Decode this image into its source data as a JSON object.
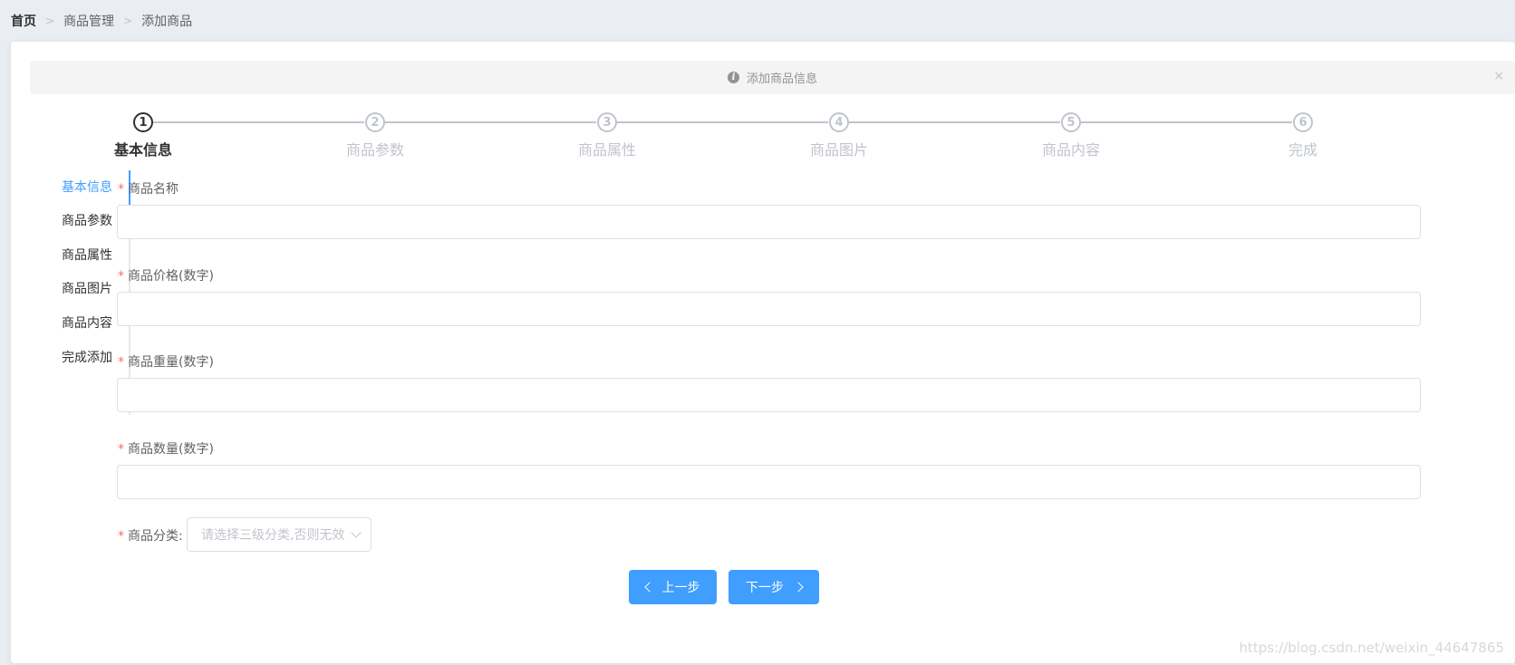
{
  "breadcrumb": [
    "首页",
    "商品管理",
    "添加商品"
  ],
  "alert": {
    "text": "添加商品信息",
    "close": "×"
  },
  "steps": [
    {
      "number": "1",
      "title": "基本信息"
    },
    {
      "number": "2",
      "title": "商品参数"
    },
    {
      "number": "3",
      "title": "商品属性"
    },
    {
      "number": "4",
      "title": "商品图片"
    },
    {
      "number": "5",
      "title": "商品内容"
    },
    {
      "number": "6",
      "title": "完成"
    }
  ],
  "active_step": "1",
  "tabs": [
    "基本信息",
    "商品参数",
    "商品属性",
    "商品图片",
    "商品内容",
    "完成添加"
  ],
  "active_tab": "基本信息",
  "form": {
    "name_label": "商品名称",
    "name_value": "",
    "price_label": "商品价格(数字)",
    "price_value": "",
    "weight_label": "商品重量(数字)",
    "weight_value": "",
    "number_label": "商品数量(数字)",
    "number_value": "",
    "category_label": "商品分类:",
    "category_placeholder": "请选择三级分类,否则无效",
    "required_mark": "*"
  },
  "buttons": {
    "prev": "上一步",
    "next": "下一步"
  },
  "watermark": "https://blog.csdn.net/weixin_44647865",
  "colors": {
    "primary": "#409eff",
    "danger": "#f56c6c",
    "step_active": "#303133",
    "step_inactive": "#c0c4cc"
  }
}
